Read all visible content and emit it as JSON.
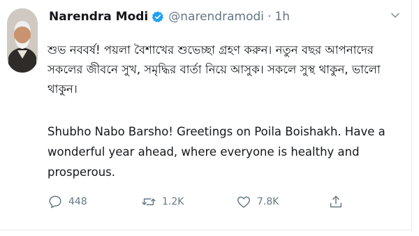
{
  "tweet": {
    "display_name": "Narendra Modi",
    "handle": "@narendramodi",
    "separator": "·",
    "time": "1h",
    "text_bengali": "শুভ নববর্ষ! পয়লা বৈশাখের শুভেচ্ছা গ্রহণ করুন। নতুন বছর আপনাদের সকলের জীবনে সুখ, সমৃদ্ধির বার্তা নিয়ে আসুক। সকলে সুস্থ থাকুন, ভালো থাকুন।",
    "text_english": "Shubho Nabo Barsho! Greetings on Poila Boishakh. Have a wonderful year ahead, where everyone is healthy and prosperous."
  },
  "actions": {
    "reply_count": "448",
    "retweet_count": "1.2K",
    "like_count": "7.8K"
  },
  "icons": {
    "verified": "verified-badge-icon",
    "caret": "chevron-down-icon",
    "reply": "reply-icon",
    "retweet": "retweet-icon",
    "like": "heart-icon",
    "share": "share-icon"
  },
  "colors": {
    "verified_blue": "#1da1f2",
    "muted_gray": "#657786",
    "text": "#14171a"
  }
}
